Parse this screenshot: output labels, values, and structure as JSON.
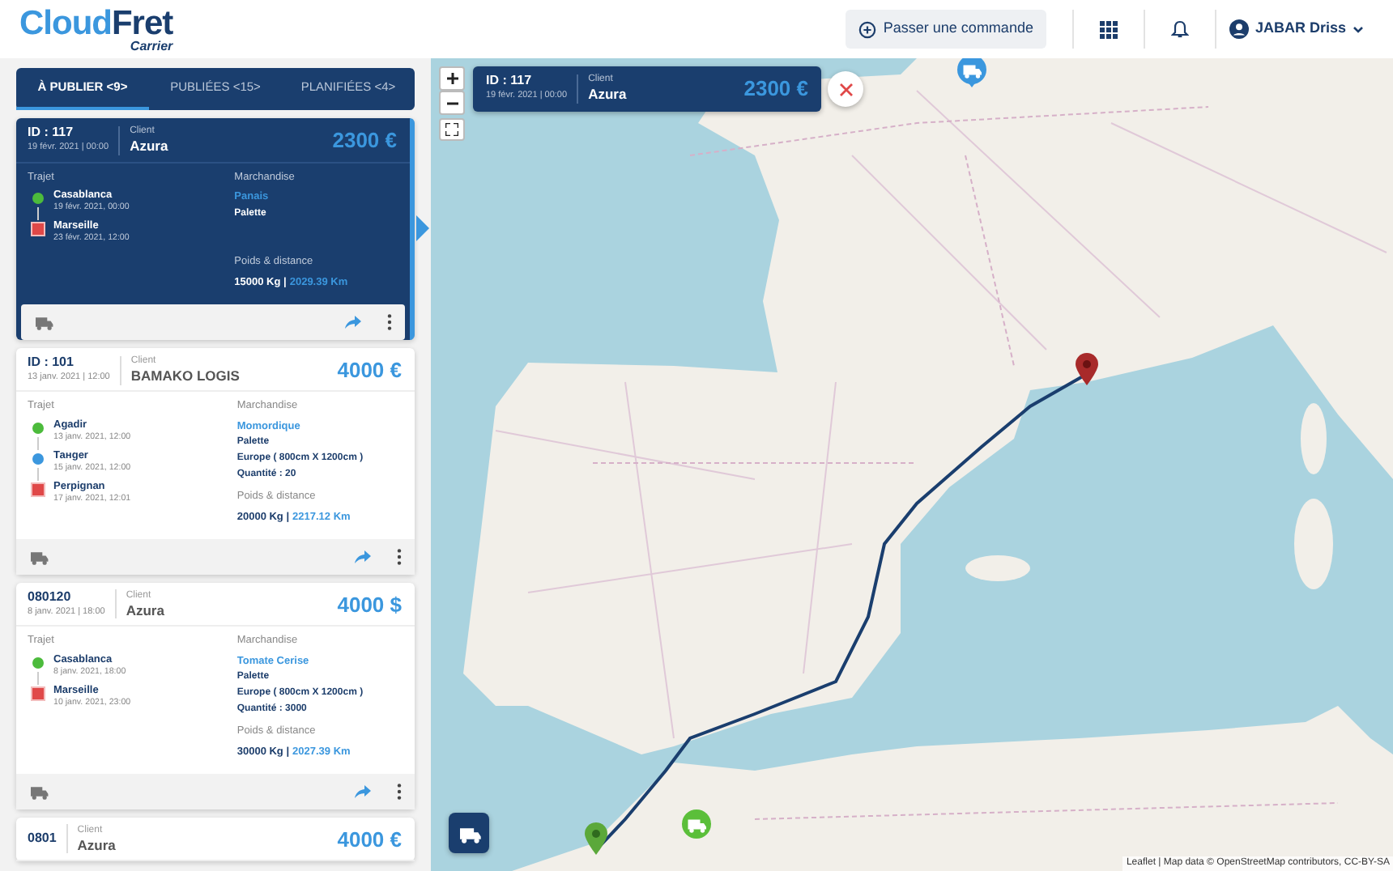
{
  "header": {
    "logo": {
      "primary": "Cloud",
      "secondary": "Fret",
      "tagline": "Carrier"
    },
    "order_button": "Passer une commande",
    "user": "JABAR Driss"
  },
  "tabs": [
    {
      "label": "À PUBLIER <9>",
      "selected": true
    },
    {
      "label": "PUBLIÉES <15>",
      "selected": false
    },
    {
      "label": "PLANIFIÉES <4>",
      "selected": false
    }
  ],
  "orders": [
    {
      "id": "ID : 117",
      "date": "19 févr. 2021 | 00:00",
      "client_label": "Client",
      "client": "Azura",
      "price": "2300 €",
      "selected": true,
      "route_label": "Trajet",
      "stops": [
        {
          "city": "Casablanca",
          "date": "19 févr. 2021, 00:00",
          "kind": "origin"
        },
        {
          "city": "Marseille",
          "date": "23 févr. 2021, 12:00",
          "kind": "destination"
        }
      ],
      "goods_label": "Marchandise",
      "goods": [
        {
          "text": "Panais",
          "kind": "product"
        },
        {
          "text": "Palette",
          "kind": "detail"
        }
      ],
      "weight_label": "Poids & distance",
      "weight": "15000 Kg |",
      "distance": "2029.39 Km"
    },
    {
      "id": "ID : 101",
      "date": "13 janv. 2021 | 12:00",
      "client_label": "Client",
      "client": "BAMAKO LOGIS",
      "price": "4000 €",
      "selected": false,
      "route_label": "Trajet",
      "stops": [
        {
          "city": "Agadir",
          "date": "13 janv. 2021, 12:00",
          "kind": "origin"
        },
        {
          "city": "Танger",
          "date": "15 janv. 2021, 12:00",
          "kind": "waypoint"
        },
        {
          "city": "Perpignan",
          "date": "17 janv. 2021, 12:01",
          "kind": "destination"
        }
      ],
      "goods_label": "Marchandise",
      "goods": [
        {
          "text": "Momordique",
          "kind": "product"
        },
        {
          "text": "Palette",
          "kind": "detail"
        },
        {
          "text": "Europe ( 800cm X 1200cm )",
          "kind": "detail"
        },
        {
          "text": "Quantité : 20",
          "kind": "detail"
        }
      ],
      "weight_label": "Poids & distance",
      "weight": "20000 Kg |",
      "distance": "2217.12 Km"
    },
    {
      "id": "080120",
      "date": "8 janv. 2021 | 18:00",
      "client_label": "Client",
      "client": "Azura",
      "price": "4000 $",
      "selected": false,
      "route_label": "Trajet",
      "stops": [
        {
          "city": "Casablanca",
          "date": "8 janv. 2021, 18:00",
          "kind": "origin"
        },
        {
          "city": "Marseille",
          "date": "10 janv. 2021, 23:00",
          "kind": "destination"
        }
      ],
      "goods_label": "Marchandise",
      "goods": [
        {
          "text": "Tomate Cerise",
          "kind": "product"
        },
        {
          "text": "Palette",
          "kind": "detail"
        },
        {
          "text": "Europe ( 800cm X 1200cm )",
          "kind": "detail"
        },
        {
          "text": "Quantité : 3000",
          "kind": "detail"
        }
      ],
      "weight_label": "Poids & distance",
      "weight": "30000 Kg |",
      "distance": "2027.39 Km"
    },
    {
      "id": "0801",
      "client_label": "Client",
      "client": "Azura",
      "price": "4000 €",
      "selected": false
    }
  ],
  "map": {
    "summary": {
      "id": "ID : 117",
      "date": "19 févr. 2021 | 00:00",
      "client_label": "Client",
      "client": "Azura",
      "price": "2300 €"
    },
    "attribution": {
      "leaflet": "Leaflet",
      "text": "| Map data ©",
      "osm": "OpenStreetMap",
      "text2": "contributors,",
      "license": "CC-BY-SA"
    }
  }
}
